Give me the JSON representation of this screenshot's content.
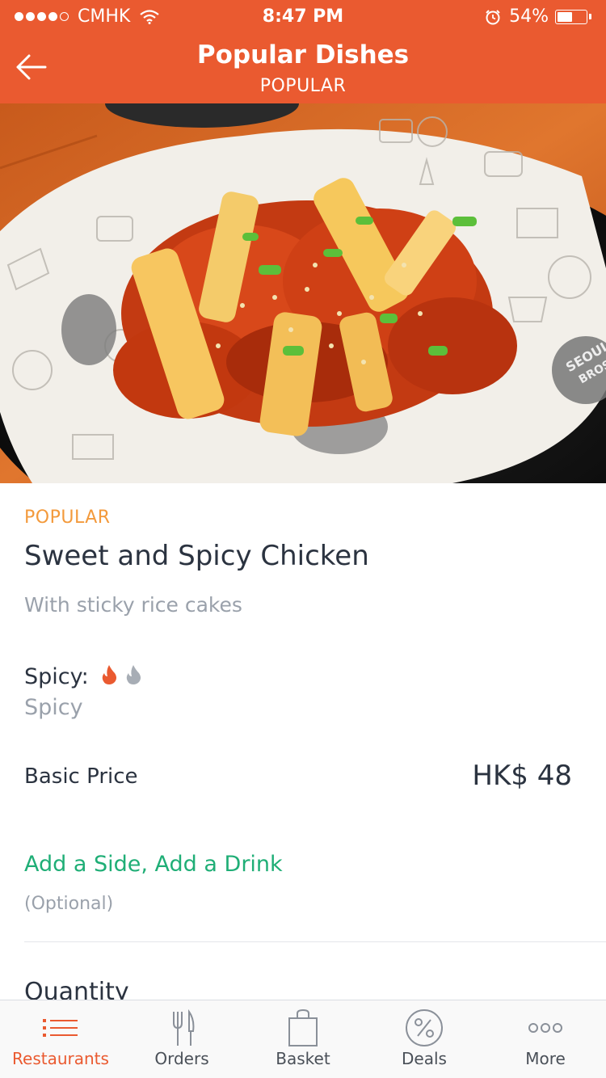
{
  "status_bar": {
    "carrier": "CMHK",
    "time": "8:47 PM",
    "battery": "54%",
    "battery_level": 0.54
  },
  "header": {
    "title": "Popular Dishes",
    "subtitle": "POPULAR"
  },
  "hero_image": {
    "logo_text_a": "SEOUL",
    "logo_text_b": "BROS"
  },
  "dish": {
    "category": "POPULAR",
    "name": "Sweet and Spicy Chicken",
    "description": "With sticky rice cakes",
    "spicy_label": "Spicy:",
    "spicy_value": "Spicy",
    "spicy_level": 1,
    "spicy_max": 2,
    "price_label": "Basic Price",
    "price": "HK$ 48",
    "addons_label": "Add a Side, Add a Drink",
    "addons_note": "(Optional)",
    "quantity_label": "Quantity"
  },
  "tabs": [
    {
      "label": "Restaurants",
      "icon": "list-icon",
      "active": true
    },
    {
      "label": "Orders",
      "icon": "fork-knife-icon",
      "active": false
    },
    {
      "label": "Basket",
      "icon": "basket-icon",
      "active": false
    },
    {
      "label": "Deals",
      "icon": "percent-icon",
      "active": false
    },
    {
      "label": "More",
      "icon": "more-icon",
      "active": false
    }
  ],
  "colors": {
    "brand": "#ea5a30",
    "category": "#f39a3c",
    "link": "#1fae76",
    "muted": "#9aa1ab",
    "text": "#2b3340"
  }
}
